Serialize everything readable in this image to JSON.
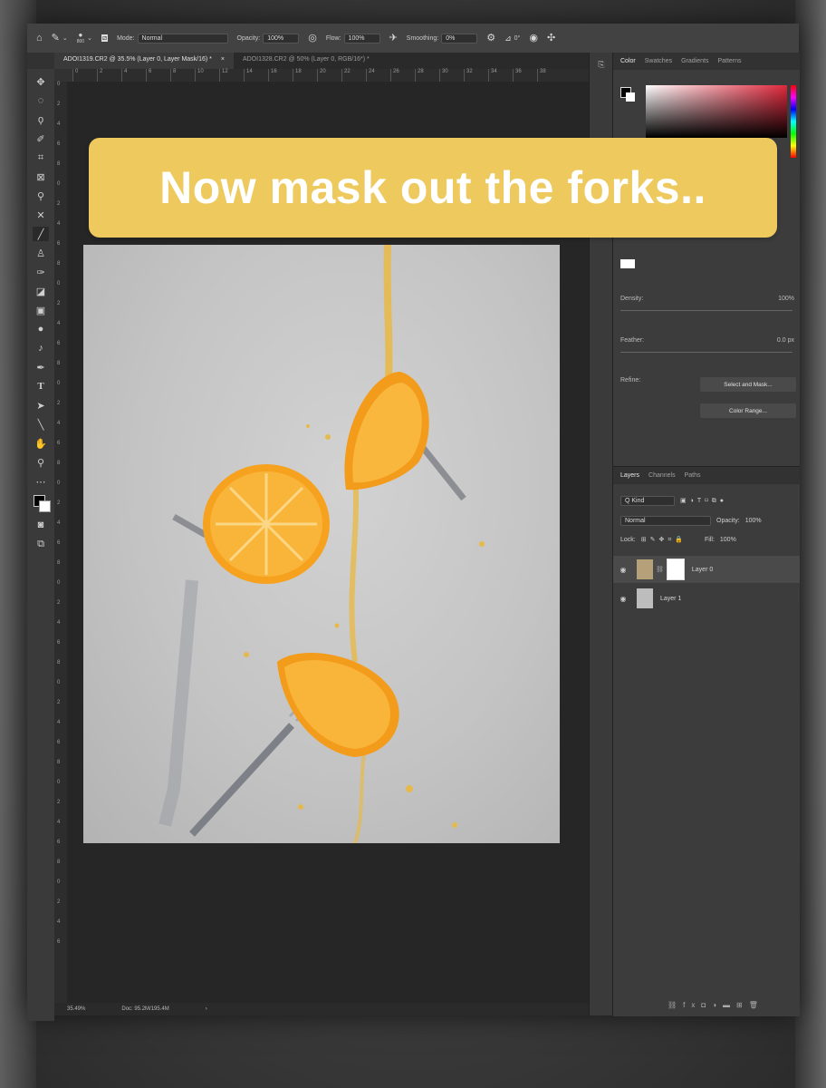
{
  "optbar": {
    "brush_size": "800",
    "mode_label": "Mode:",
    "mode_value": "Normal",
    "opacity_label": "Opacity:",
    "opacity_value": "100%",
    "flow_label": "Flow:",
    "flow_value": "100%",
    "smoothing_label": "Smoothing:",
    "smoothing_value": "0%",
    "angle_value": "0°"
  },
  "tabs": [
    {
      "label": "ADOI1319.CR2 @ 35.5% (Layer 0, Layer Mask/16) *"
    },
    {
      "label": "ADOI1328.CR2 @ 50% (Layer 0, RGB/16*) *"
    }
  ],
  "ruler_h": [
    "0",
    "2",
    "4",
    "6",
    "8",
    "10",
    "12",
    "14",
    "16",
    "18",
    "20",
    "22",
    "24",
    "26",
    "28",
    "30",
    "32",
    "34",
    "36",
    "38"
  ],
  "ruler_v": [
    "0",
    "2",
    "4",
    "6",
    "8",
    "0",
    "2",
    "4",
    "6",
    "8",
    "0",
    "2",
    "4",
    "6",
    "8",
    "0",
    "2",
    "4",
    "6",
    "8",
    "0",
    "2",
    "4",
    "6",
    "8",
    "0",
    "2",
    "4",
    "6",
    "8",
    "0",
    "2",
    "4",
    "6",
    "8",
    "0",
    "2",
    "4",
    "6",
    "8",
    "0",
    "2",
    "4",
    "6"
  ],
  "caption": "Now mask out the forks..",
  "status": {
    "zoom": "35.49%",
    "doc": "Doc: 95.2M/195.4M"
  },
  "panel_tabs": [
    {
      "label": "Color"
    },
    {
      "label": "Swatches"
    },
    {
      "label": "Gradients"
    },
    {
      "label": "Patterns"
    }
  ],
  "properties": {
    "density_label": "Density:",
    "density_value": "100%",
    "feather_label": "Feather:",
    "feather_value": "0.0 px",
    "refine_label": "Refine:",
    "select_mask_label": "Select and Mask...",
    "color_range_label": "Color Range..."
  },
  "layers_tabs": [
    {
      "label": "Layers"
    },
    {
      "label": "Channels"
    },
    {
      "label": "Paths"
    }
  ],
  "layers_controls": {
    "kind_label": "Q Kind",
    "blend_mode": "Normal",
    "opacity_label": "Opacity:",
    "opacity_value": "100%",
    "lock_label": "Lock:",
    "fill_label": "Fill:",
    "fill_value": "100%"
  },
  "layers": [
    {
      "name": "Layer 0"
    },
    {
      "name": "Layer 1"
    }
  ],
  "colors": {
    "caption_bg": "#edc95e",
    "app_bg": "#323232",
    "panel_bg": "#3c3c3c",
    "orange": "#f3a01e",
    "juice": "#e7b94a"
  }
}
